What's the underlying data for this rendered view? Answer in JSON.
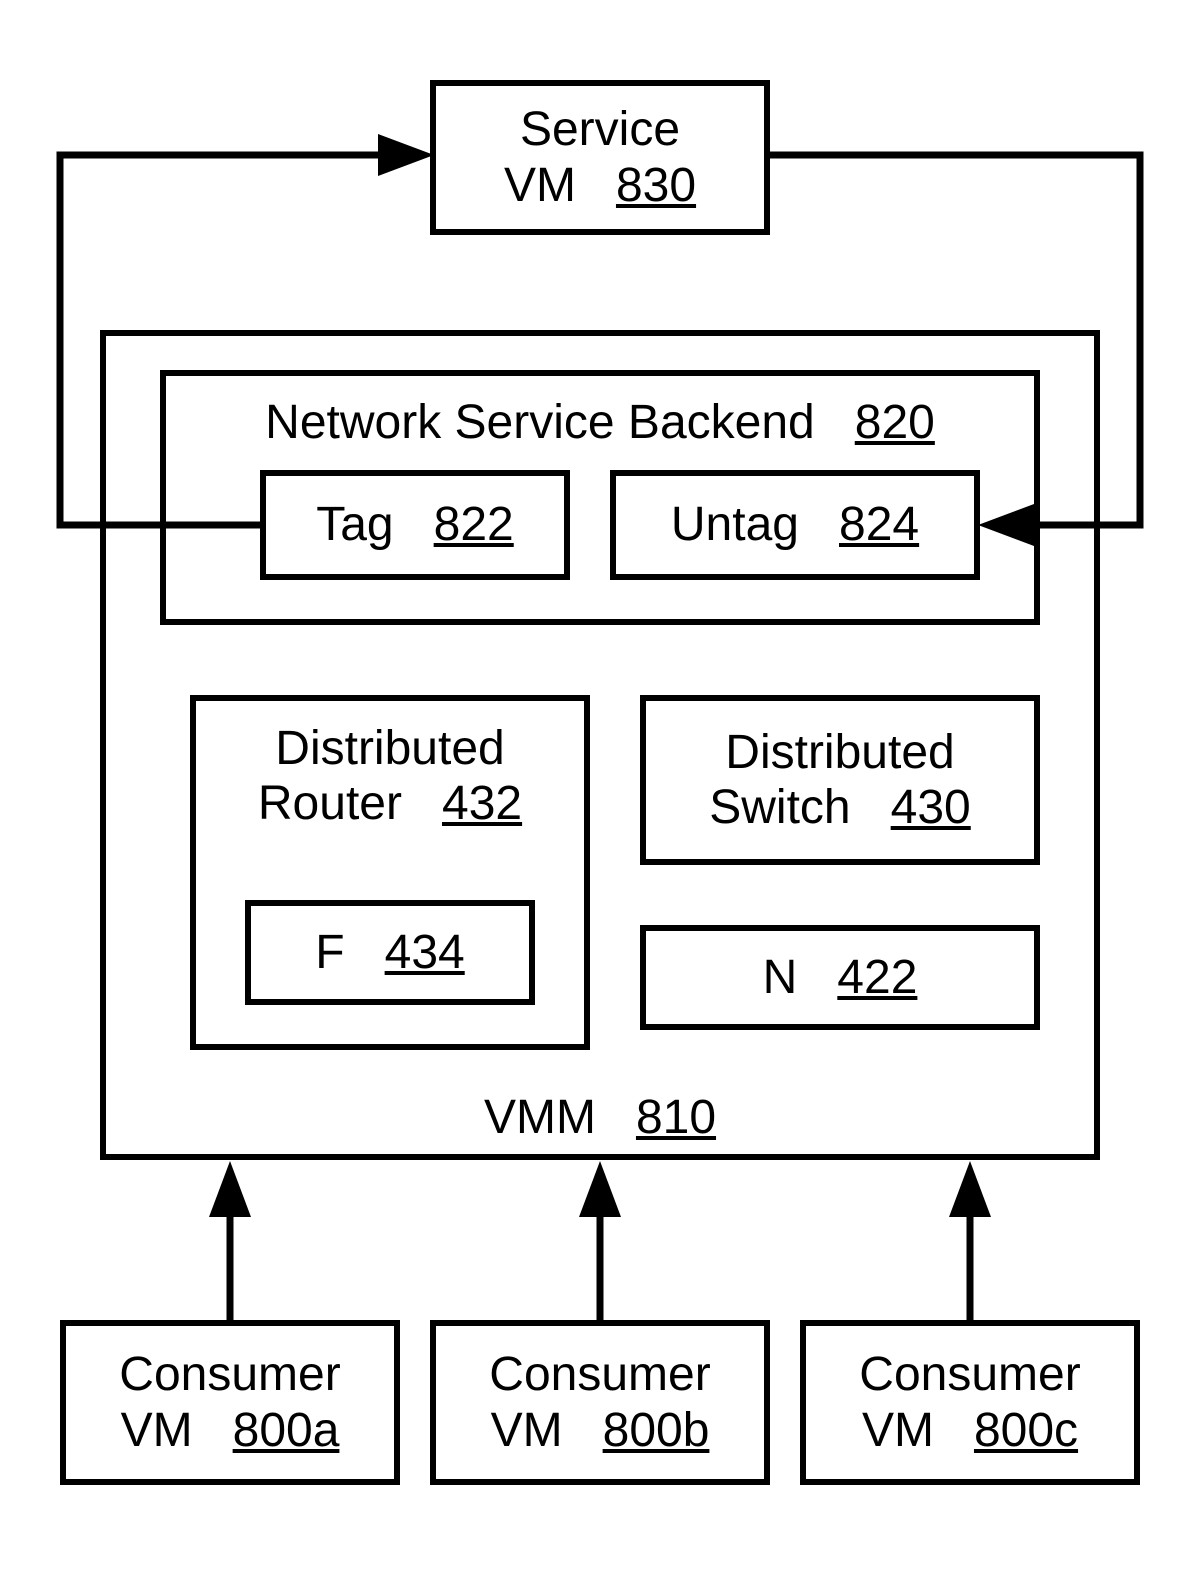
{
  "service_vm": {
    "label": "Service",
    "sub": "VM",
    "ref": "830"
  },
  "vmm": {
    "label": "VMM",
    "ref": "810"
  },
  "backend": {
    "label": "Network Service Backend",
    "ref": "820"
  },
  "tag": {
    "label": "Tag",
    "ref": "822"
  },
  "untag": {
    "label": "Untag",
    "ref": "824"
  },
  "dist_router": {
    "label1": "Distributed",
    "label2": "Router",
    "ref": "432"
  },
  "f_box": {
    "label": "F",
    "ref": "434"
  },
  "dist_switch": {
    "label1": "Distributed",
    "label2": "Switch",
    "ref": "430"
  },
  "n_box": {
    "label": "N",
    "ref": "422"
  },
  "consumer_a": {
    "label1": "Consumer",
    "label2": "VM",
    "ref": "800a"
  },
  "consumer_b": {
    "label1": "Consumer",
    "label2": "VM",
    "ref": "800b"
  },
  "consumer_c": {
    "label1": "Consumer",
    "label2": "VM",
    "ref": "800c"
  }
}
